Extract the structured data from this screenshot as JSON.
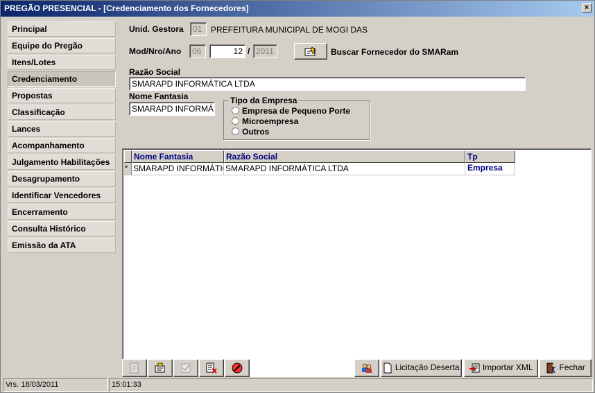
{
  "window": {
    "title": "PREGÃO PRESENCIAL - [Credenciamento dos Fornecedores]",
    "close_label": "×"
  },
  "sidebar": {
    "items": [
      {
        "label": "Principal"
      },
      {
        "label": "Equipe do Pregão"
      },
      {
        "label": "Itens/Lotes"
      },
      {
        "label": "Credenciamento"
      },
      {
        "label": "Propostas"
      },
      {
        "label": "Classificação"
      },
      {
        "label": "Lances"
      },
      {
        "label": "Acompanhamento"
      },
      {
        "label": "Julgamento Habilitações"
      },
      {
        "label": "Desagrupamento"
      },
      {
        "label": "Identificar Vencedores"
      },
      {
        "label": "Encerramento"
      },
      {
        "label": "Consulta Histórico"
      },
      {
        "label": "Emissão da ATA"
      }
    ],
    "active_index": 3
  },
  "form": {
    "unid_label": "Unid. Gestora",
    "unid_code": "01",
    "unid_name": "PREFEITURA MUNICIPAL DE MOGI DAS",
    "mod_label": "Mod/Nro/Ano",
    "mod_value": "06",
    "nro_value": "12",
    "slash": "/",
    "ano_value": "2011",
    "buscar_label": "Buscar Fornecedor do SMARam",
    "razao_label": "Razão Social",
    "razao_value": "SMARAPD INFORMÁTICA LTDA",
    "fantasia_label": "Nome Fantasia",
    "fantasia_value": "SMARAPD INFORMÁTICA LTDA",
    "tipo_title": "Tipo da Empresa",
    "tipo_options": [
      "Empresa de Pequeno Porte",
      "Microempresa",
      "Outros"
    ]
  },
  "grid": {
    "columns": [
      "Nome Fantasia",
      "Razão Social",
      "Tp Empresa"
    ],
    "rows": [
      {
        "marker": "*",
        "nome_fantasia": "SMARAPD INFORMÁTICA LTDA",
        "razao_social": "SMARAPD INFORMÁTICA LTDA",
        "tp_empresa": ""
      }
    ]
  },
  "toolbar": {
    "deserta_label": "Licitação Deserta",
    "importar_label": "Importar XML",
    "fechar_label": "Fechar"
  },
  "status": {
    "version": "Vrs. 18/03/2011",
    "time": "15:01:33"
  },
  "colors": {
    "title_start": "#0a246a",
    "title_end": "#a6caf0",
    "grid_header_text": "#000080",
    "background": "#d4d0c8"
  }
}
